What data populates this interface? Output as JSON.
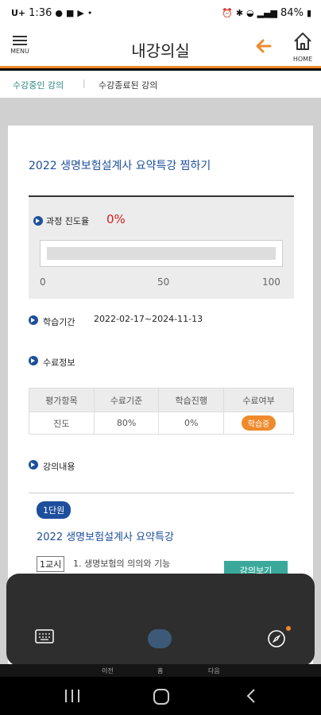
{
  "status_bar": {
    "time": "1:36",
    "carrier_icon": "U+",
    "battery": "84%"
  },
  "app_bar": {
    "menu_label": "MENU",
    "title": "내강의실",
    "home_label": "HOME",
    "accent_color": "#ef8a2c"
  },
  "tabs": {
    "active": "수강중인 강의",
    "inactive": "수강종료된 강의"
  },
  "course": {
    "title": "2022 생명보험설계사 요약특강  찜하기",
    "progress_label": "과정 진도율",
    "progress_value": "0%",
    "progress_fraction": 0,
    "progress_ticks": [
      "0",
      "50",
      "100"
    ],
    "period_label": "학습기간",
    "period_value": "2022-02-17~2024-11-13",
    "completion_label": "수료정보",
    "table_headers": [
      "평가항목",
      "수료기준",
      "학습진행",
      "수료여부"
    ],
    "table_row": [
      "진도",
      "80%",
      "0%",
      "학습중"
    ],
    "content_label": "강의내용"
  },
  "unit": {
    "badge": "1단원",
    "title": "2022 생명보험설계사 요약특강",
    "lesson_no": "1교시",
    "lesson_title": "1. 생명보험의 의의와 기능",
    "view_button": "강의보기"
  },
  "web_nav": {
    "prev": "이전",
    "home": "홈",
    "next": "다음"
  }
}
